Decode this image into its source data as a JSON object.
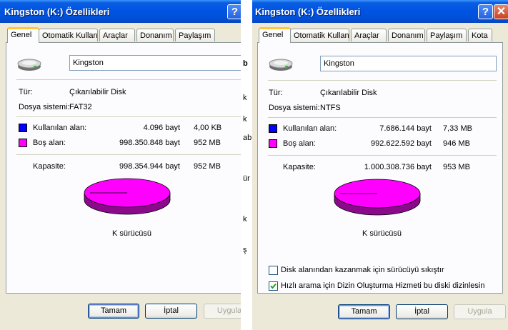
{
  "left_window": {
    "title": "Kingston (K:) Özellikleri",
    "help_label": "?",
    "tabs": [
      "Genel",
      "Otomatik Kullan",
      "Araçlar",
      "Donanım",
      "Paylaşım"
    ],
    "volume_name": "Kingston",
    "type_label": "Tür:",
    "type_value": "Çıkarılabilir Disk",
    "fs_label": "Dosya sistemi:",
    "fs_value": "FAT32",
    "used_label": "Kullanılan alan:",
    "used_bytes": "4.096 bayt",
    "used_size": "4,00 KB",
    "free_label": "Boş alan:",
    "free_bytes": "998.350.848 bayt",
    "free_size": "952 MB",
    "capacity_label": "Kapasite:",
    "capacity_bytes": "998.354.944 bayt",
    "capacity_size": "952 MB",
    "drive_label": "K sürücüsü",
    "ok_label": "Tamam",
    "cancel_label": "İptal",
    "apply_label": "Uygula"
  },
  "right_window": {
    "title": "Kingston (K:) Özellikleri",
    "help_label": "?",
    "close_label": "✕",
    "tabs": [
      "Genel",
      "Otomatik Kullan",
      "Araçlar",
      "Donanım",
      "Paylaşım",
      "Kota"
    ],
    "volume_name": "Kingston",
    "type_label": "Tür:",
    "type_value": "Çıkarılabilir Disk",
    "fs_label": "Dosya sistemi:",
    "fs_value": "NTFS",
    "used_label": "Kullanılan alan:",
    "used_bytes": "7.686.144 bayt",
    "used_size": "7,33 MB",
    "free_label": "Boş alan:",
    "free_bytes": "992.622.592 bayt",
    "free_size": "946 MB",
    "capacity_label": "Kapasite:",
    "capacity_bytes": "1.000.308.736 bayt",
    "capacity_size": "953 MB",
    "drive_label": "K sürücüsü",
    "compress_label": "Disk alanından kazanmak için sürücüyü sıkıştır",
    "compress_checked": false,
    "index_label": "Hızlı arama için Dizin Oluşturma Hizmeti bu diski dizinlesin",
    "index_checked": true,
    "ok_label": "Tamam",
    "cancel_label": "İptal",
    "apply_label": "Uygula"
  },
  "background_strip_glyphs": [
    "b",
    "k",
    "k",
    "ab",
    "ür",
    "k",
    "ş"
  ],
  "colors": {
    "used": "#0000ff",
    "free": "#ff00ff",
    "free_dark": "#8b0a8b",
    "title_bar": "#0054e3",
    "dialog_bg": "#ece9d8"
  }
}
